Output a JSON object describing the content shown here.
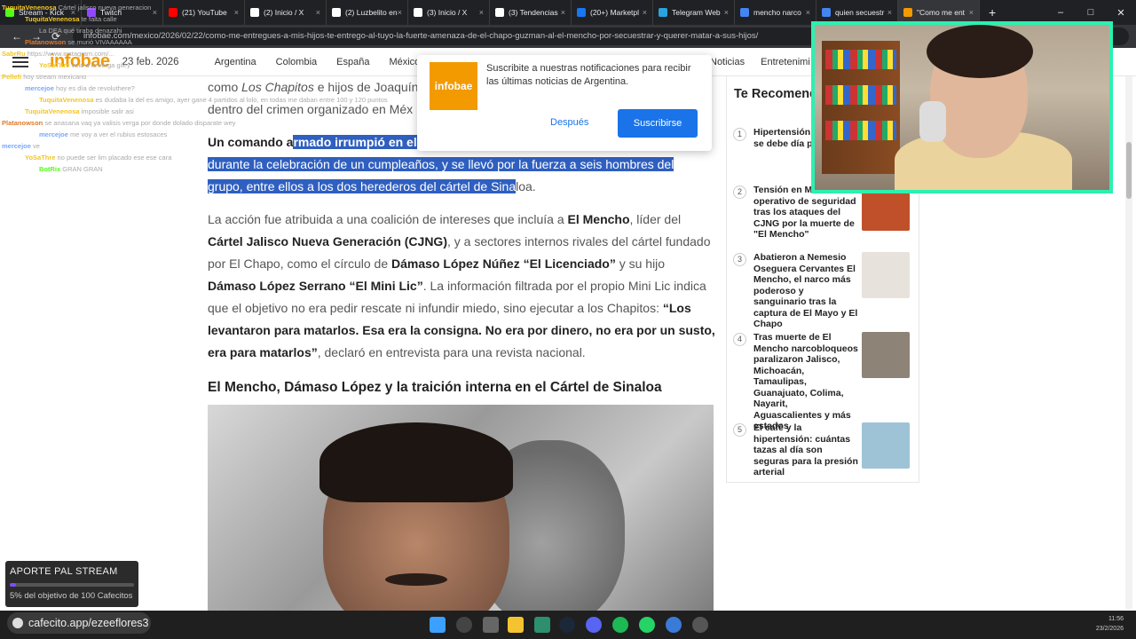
{
  "browser": {
    "tabs": [
      {
        "label": "Stream - Kick",
        "color": "#53fc18"
      },
      {
        "label": "Twitch",
        "color": "#9146ff"
      },
      {
        "label": "(21) YouTube",
        "color": "#ff0000"
      },
      {
        "label": "(2) Inicio / X",
        "color": "#ffffff"
      },
      {
        "label": "(2) Luzbelito en",
        "color": "#ffffff"
      },
      {
        "label": "(3) Inicio / X",
        "color": "#ffffff"
      },
      {
        "label": "(3) Tendencias",
        "color": "#ffffff"
      },
      {
        "label": "(20+) Marketpl",
        "color": "#1877f2"
      },
      {
        "label": "Telegram Web",
        "color": "#2aa3df"
      },
      {
        "label": "mencho narco",
        "color": "#4285f4"
      },
      {
        "label": "quien secuestr",
        "color": "#4285f4"
      },
      {
        "label": "\"Como me ent",
        "color": "#f29a00"
      }
    ],
    "new_tab": "+",
    "url": "infobae.com/mexico/2026/02/22/como-me-entregues-a-mis-hijos-te-entrego-al-tuyo-la-fuerte-amenaza-de-el-chapo-guzman-al-el-mencho-por-secuestrar-y-querer-matar-a-sus-hijos/"
  },
  "site": {
    "logo": "infobae",
    "date": "23 feb. 2026",
    "nav": [
      "Argentina",
      "Colombia",
      "España",
      "México"
    ],
    "nav_right": [
      "Noticias",
      "Entretenimi"
    ]
  },
  "article": {
    "p0_a": "como ",
    "p0_b": "Los Chapitos",
    "p0_c": " e hijos de Joaquín",
    "p0_d": "dentro del crimen organizado en Méx",
    "p1_a": "Un comando a",
    "p1_hl1": "rmado irrumpió en el",
    "p1_hl2": "durante la celebración de un cumpleaños, y se llevó por la fuerza a seis hombres del",
    "p1_hl3": "grupo, entre ellos a los dos herederos del cártel de Sina",
    "p1_end": "loa.",
    "p2_a": "La acción fue atribuida a una coalición de intereses que incluía a ",
    "p2_b": "El Mencho",
    "p2_c": ", líder del ",
    "p2_d": "Cártel Jalisco Nueva Generación (CJNG)",
    "p2_e": ", y a sectores internos rivales del cártel fundado por El Chapo, como el círculo de ",
    "p2_f": "Dámaso López Núñez “El Licenciado”",
    "p2_g": " y su hijo ",
    "p2_h": "Dámaso López Serrano “El Mini Lic”",
    "p2_i": ". La información filtrada por el propio Mini Lic indica que el objetivo no era pedir rescate ni infundir miedo, sino ejecutar a los Chapitos: ",
    "p2_j": "“Los levantaron para matarlos. Esa era la consigna. No era por dinero, no era por un susto, era para matarlos”",
    "p2_k": ", declaró en entrevista para una revista nacional.",
    "h2": "El Mencho, Dámaso López y la traición interna en el Cártel de Sinaloa"
  },
  "sidebar": {
    "title": "Te Recomend",
    "items": [
      {
        "n": "1",
        "text": "Hipertensión y cuánto se debe día para cuidar",
        "thumb": "#d9d9d9"
      },
      {
        "n": "2",
        "text": "Tensión en Méx operativo de seguridad tras los ataques del CJNG por la muerte de \"El Mencho\"",
        "thumb": "#c0502a"
      },
      {
        "n": "3",
        "text": "Abatieron a Nemesio Oseguera Cervantes El Mencho, el narco más poderoso y sanguinario tras la captura de El Mayo y El Chapo",
        "thumb": "#e8e2dc"
      },
      {
        "n": "4",
        "text": "Tras muerte de El Mencho narcobloqueos paralizaron Jalisco, Michoacán, Tamaulipas, Guanajuato, Colima, Nayarit, Aguascalientes y más estados",
        "thumb": "#8d8376"
      },
      {
        "n": "5",
        "text": "El café y la hipertensión: cuántas tazas al día son seguras para la presión arterial",
        "thumb": "#9fc3d6"
      }
    ]
  },
  "popup": {
    "logo": "infobae",
    "text": "Suscribite a nuestras notificaciones para recibir las últimas noticias de Argentina.",
    "later": "Después",
    "subscribe": "Suscribirse"
  },
  "chat": [
    {
      "user": "TuquitaVenenosa",
      "msg": "Cártel jalisco nueva generacion",
      "color": "#f3c623"
    },
    {
      "user": "TuquitaVenenosa",
      "msg": "te falta calle",
      "color": "#f3c623"
    },
    {
      "user": "",
      "msg": "La DEA qué tiraba denazahi",
      "color": "#ffffff"
    },
    {
      "user": "Platanowson",
      "msg": "se murió VIVAAAAAA",
      "color": "#e07a2a"
    },
    {
      "user": "SabrRu",
      "msg": "https://www.instagram.com/...",
      "color": "#f3c623"
    },
    {
      "user": "YoSaThre",
      "msg": "veio a la verga giley",
      "color": "#f3c623"
    },
    {
      "user": "Pellefi",
      "msg": "hoy stream mexicano",
      "color": "#f3c623"
    },
    {
      "user": "mercejoe",
      "msg": "hoy es día de revoluthere?",
      "color": "#7aa7ff"
    },
    {
      "user": "TuquitaVenenosa",
      "msg": "es dudaba la del es amigo, ayer gane 4 partidos al lolo, en todas me daban entre 100 y 120 puntos",
      "color": "#f3c623"
    },
    {
      "user": "TuquitaVenenosa",
      "msg": "imposible salir asi",
      "color": "#f3c623"
    },
    {
      "user": "Platanowson",
      "msg": "se anasana vaq ya valisis verga por donde dolado disparate wey",
      "color": "#e07a2a"
    },
    {
      "user": "mercejoe",
      "msg": "me voy a ver el rubius estosaces",
      "color": "#7aa7ff"
    },
    {
      "user": "mercejoe",
      "msg": "ve",
      "color": "#7aa7ff"
    },
    {
      "user": "YoSaThre",
      "msg": "no puede ser lim placado ese ese cara",
      "color": "#f3c623"
    },
    {
      "user": "BotRix",
      "msg": "GRAN GRAN",
      "color": "#53fc18"
    }
  ],
  "donation": {
    "title": "APORTE PAL STREAM",
    "status": "5% del objetivo de 100 Cafecitos",
    "progress": 0.05
  },
  "taskbar": {
    "cafe": "cafecito.app/ezeeflores3",
    "clock_time": "11:56",
    "clock_date": "23/2/2026"
  }
}
